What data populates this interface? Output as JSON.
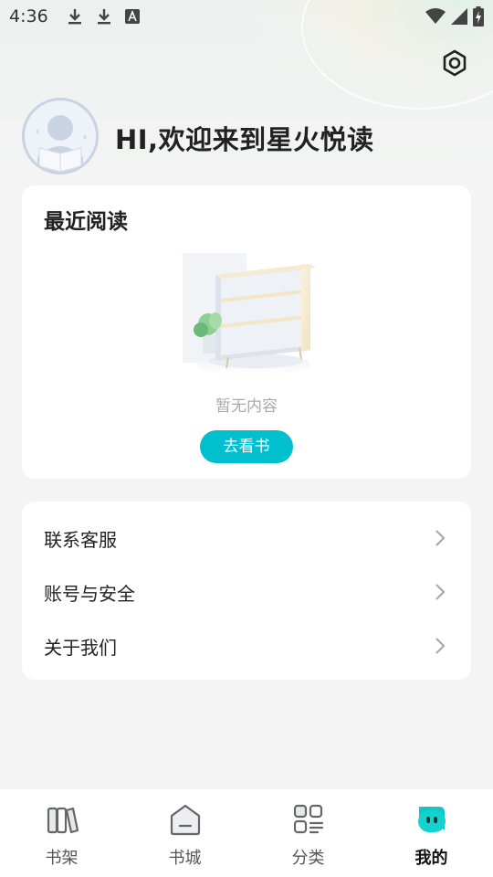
{
  "status_bar": {
    "time": "4:36",
    "left_icons": [
      "download-icon",
      "download-icon",
      "font-a-icon"
    ],
    "right_icons": [
      "wifi-icon",
      "signal-icon",
      "battery-charging-icon"
    ]
  },
  "header": {
    "greeting": "HI,欢迎来到星火悦读",
    "settings_icon": "settings-icon"
  },
  "recent_reading": {
    "title": "最近阅读",
    "empty_text": "暂无内容",
    "button_label": "去看书"
  },
  "menu": {
    "items": [
      {
        "label": "联系客服"
      },
      {
        "label": "账号与安全"
      },
      {
        "label": "关于我们"
      }
    ]
  },
  "tabbar": {
    "tabs": [
      {
        "label": "书架",
        "icon": "bookshelf-icon",
        "active": false
      },
      {
        "label": "书城",
        "icon": "bookstore-icon",
        "active": false
      },
      {
        "label": "分类",
        "icon": "category-icon",
        "active": false
      },
      {
        "label": "我的",
        "icon": "profile-icon",
        "active": true
      }
    ]
  },
  "colors": {
    "accent": "#00bfcf",
    "background": "#f4f4f4",
    "card": "#ffffff"
  }
}
